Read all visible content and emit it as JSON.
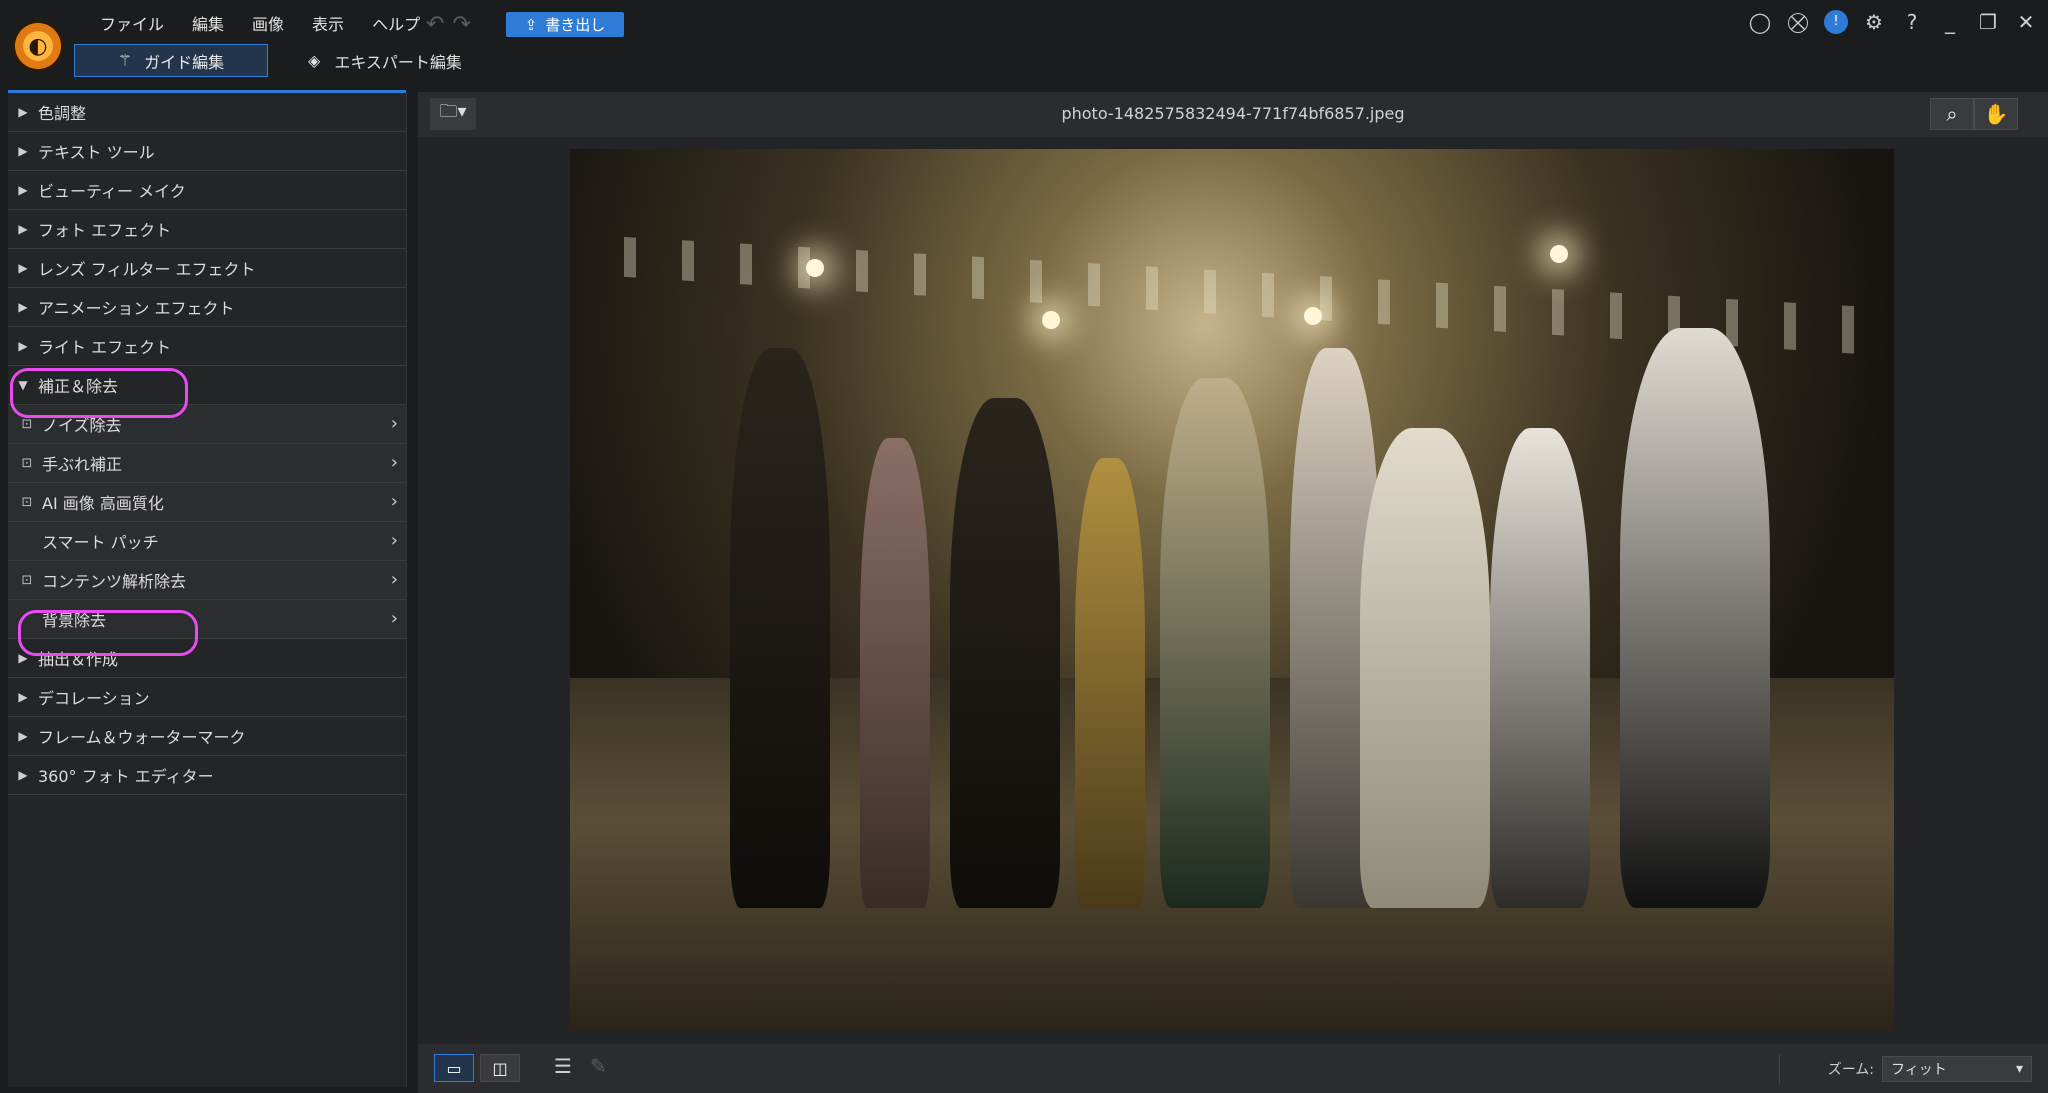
{
  "menu": [
    "ファイル",
    "編集",
    "画像",
    "表示",
    "ヘルプ"
  ],
  "export_label": "書き出し",
  "tabs": {
    "guide": "ガイド編集",
    "expert": "エキスパート編集"
  },
  "sidebar": {
    "items_top": [
      "色調整",
      "テキスト ツール",
      "ビューティー メイク",
      "フォト エフェクト",
      "レンズ フィルター エフェクト",
      "アニメーション エフェクト",
      "ライト エフェクト"
    ],
    "expanded": "補正＆除去",
    "subitems": [
      "ノイズ除去",
      "手ぶれ補正",
      "AI 画像 高画質化",
      "スマート パッチ",
      "コンテンツ解析除去",
      "背景除去"
    ],
    "items_bottom": [
      "抽出＆作成",
      "デコレーション",
      "フレーム＆ウォーターマーク",
      "360° フォト エディター"
    ]
  },
  "filename": "photo-1482575832494-771f74bf6857.jpeg",
  "zoom": {
    "label": "ズーム:",
    "value": "フィット"
  },
  "highlight_color": "#e84cf0",
  "accent_color": "#2e7bd8"
}
